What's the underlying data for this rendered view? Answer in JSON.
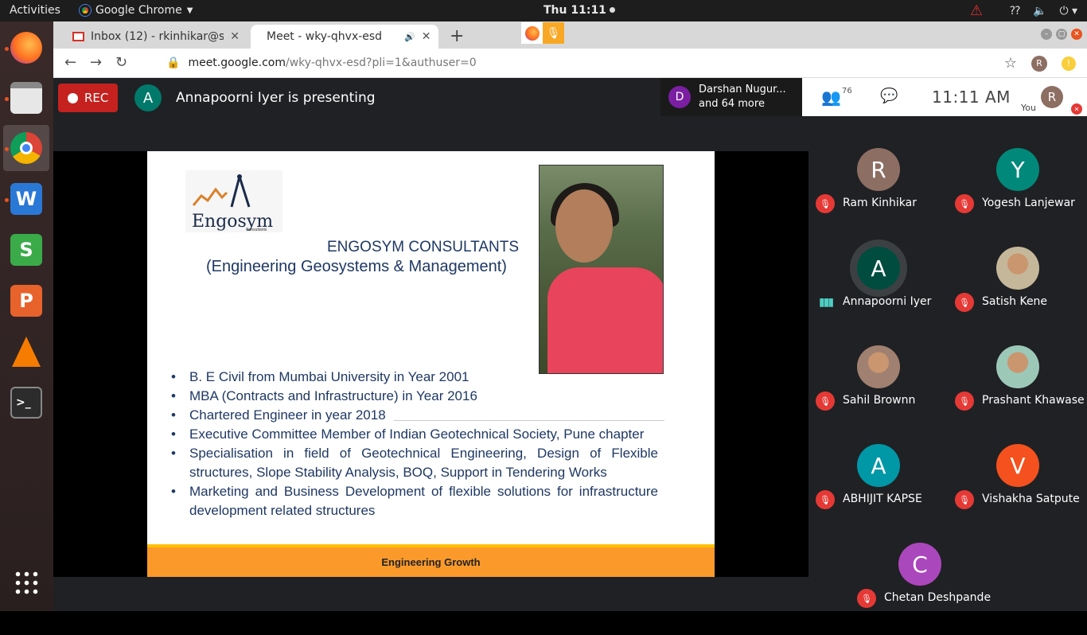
{
  "topbar": {
    "activities": "Activities",
    "app_name": "Google Chrome",
    "clock": "Thu 11:11"
  },
  "tabs": [
    {
      "label": "Inbox (12) - rkinhikar@stv"
    },
    {
      "label": "Meet - wky-qhvx-esd"
    }
  ],
  "toolbar": {
    "url_host": "meet.google.com",
    "url_path": "/wky-qhvx-esd?pli=1&authuser=0",
    "profile_initial": "R"
  },
  "meet": {
    "rec_label": "REC",
    "presenter_initial": "A",
    "presenter_text": "Annapoorni Iyer is presenting",
    "others_initial": "D",
    "others_line1": "Darshan Nugur...",
    "others_line2": "and 64 more",
    "people_count": "76",
    "time": "11:11  AM",
    "you_label": "You",
    "you_initial": "R"
  },
  "slide": {
    "logo_text": "Engosym",
    "logo_sub": "Consultants",
    "company": "ENGOSYM CONSULTANTS",
    "company_sub": "(Engineering Geosystems & Management)",
    "bullets": [
      "B. E Civil from Mumbai University in Year 2001",
      "MBA (Contracts and Infrastructure) in Year 2016",
      "Chartered Engineer in year 2018",
      "Executive Committee Member of Indian Geotechnical Society, Pune chapter",
      "Specialisation in field of Geotechnical Engineering, Design of Flexible structures, Slope Stability Analysis, BOQ, Support in Tendering Works",
      "Marketing and Business Development of flexible solutions for infrastructure development related structures"
    ],
    "footer": "Engineering Growth"
  },
  "participants": [
    {
      "name": "Ram Kinhikar",
      "initial": "R",
      "color": "#8d6e63"
    },
    {
      "name": "Yogesh Lanjewar",
      "initial": "Y",
      "color": "#00897b"
    },
    {
      "name": "Annapoorni Iyer",
      "initial": "A",
      "color": "#004d40"
    },
    {
      "name": "Satish Kene",
      "initial": "",
      "color": "#c5b89a"
    },
    {
      "name": "Sahil Brownn",
      "initial": "",
      "color": "#a08070"
    },
    {
      "name": "Prashant Khawase",
      "initial": "",
      "color": "#9cc8b8"
    },
    {
      "name": "ABHIJIT KAPSE",
      "initial": "A",
      "color": "#0097a7"
    },
    {
      "name": "Vishakha Satpute",
      "initial": "V",
      "color": "#f4511e"
    },
    {
      "name": "Chetan Deshpande",
      "initial": "C",
      "color": "#ab47bc"
    }
  ]
}
